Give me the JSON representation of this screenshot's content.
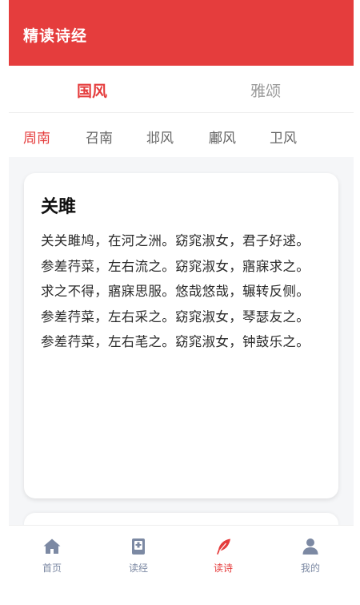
{
  "header": {
    "title": "精读诗经"
  },
  "main_tabs": [
    {
      "label": "国风",
      "active": true
    },
    {
      "label": "雅颂",
      "active": false
    }
  ],
  "sub_tabs": [
    {
      "label": "周南",
      "active": true
    },
    {
      "label": "召南",
      "active": false
    },
    {
      "label": "邶风",
      "active": false
    },
    {
      "label": "鄘风",
      "active": false
    },
    {
      "label": "卫风",
      "active": false
    }
  ],
  "poem": {
    "title": "关雎",
    "lines": [
      "关关雎鸠，在河之洲。窈窕淑女，君子好逑。",
      "参差荇菜，左右流之。窈窕淑女，寤寐求之。",
      "求之不得，寤寐思服。悠哉悠哉，辗转反侧。",
      "参差荇菜，左右采之。窈窕淑女，琴瑟友之。",
      "参差荇菜，左右芼之。窈窕淑女，钟鼓乐之。"
    ]
  },
  "bottom_nav": [
    {
      "label": "首页",
      "icon": "home-icon",
      "active": false
    },
    {
      "label": "读经",
      "icon": "book-icon",
      "active": false
    },
    {
      "label": "读诗",
      "icon": "feather-icon",
      "active": true
    },
    {
      "label": "我的",
      "icon": "user-icon",
      "active": false
    }
  ],
  "colors": {
    "accent": "#e53d3d",
    "inactive_nav": "#7c89a3",
    "background": "#f5f6f8"
  }
}
